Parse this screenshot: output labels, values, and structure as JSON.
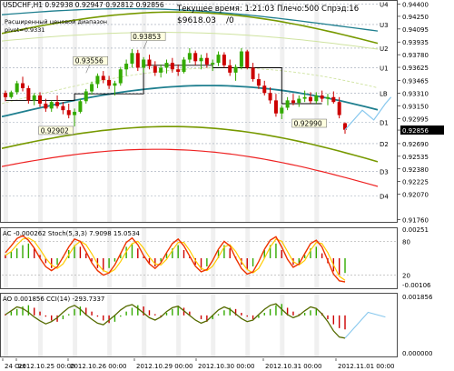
{
  "header": {
    "symbol_line": "USDCHF,H1  0.92938 0.92947 0.92812 0.92856",
    "range_label": "Расширенный ценовой диапазон",
    "pivot_label": "pivot=0.9331",
    "time_label": "Текущее время: 1:21:03 Плечо:500 Спрэд:16",
    "balance_label": "$9618.03",
    "balance_extra": "/0"
  },
  "colors": {
    "background": "#ffffff",
    "candle_up": "#33aa00",
    "candle_down": "#cc0000",
    "band_outer": "#779900",
    "band_mid": "#cfe3a0",
    "ma_teal": "#1f7f8f",
    "ma_red": "#ee2222",
    "level_line": "#9aa5b5",
    "forecast": "#88c8ee",
    "stoch_main": "#ee3300",
    "stoch_signal": "#ffcc00",
    "ac_up": "#33aa00",
    "ac_down": "#cc0000",
    "cci": "#556b00"
  },
  "chart_data": [
    {
      "type": "candlestick",
      "symbol": "USDCHF",
      "timeframe": "H1",
      "last_price": 0.92856,
      "ohlc_current": {
        "open": 0.92938,
        "high": 0.92947,
        "low": 0.92812,
        "close": 0.92856
      },
      "ylim": [
        0.9172,
        0.9445
      ],
      "y_ticks": [
        "0.94400",
        "0.94250",
        "0.94095",
        "0.93935",
        "0.93780",
        "0.93625",
        "0.93465",
        "0.93310",
        "0.93150",
        "0.92995",
        "0.92856",
        "0.92690",
        "0.92535",
        "0.92380",
        "0.92225",
        "0.92070",
        "0.91760"
      ],
      "pivot_levels": [
        {
          "name": "U4",
          "value": 0.944
        },
        {
          "name": "U3",
          "value": 0.9415
        },
        {
          "name": "U2",
          "value": 0.9386
        },
        {
          "name": "U1",
          "value": 0.9362
        },
        {
          "name": "LB",
          "value": 0.9331
        },
        {
          "name": "D1",
          "value": 0.9295
        },
        {
          "name": "D2",
          "value": 0.9269
        },
        {
          "name": "D3",
          "value": 0.9235
        },
        {
          "name": "D4",
          "value": 0.9205
        }
      ],
      "annotations": [
        {
          "text": "0.93853",
          "value": 0.93853
        },
        {
          "text": "0.93556",
          "value": 0.93556
        },
        {
          "text": "0.92902",
          "value": 0.92902
        },
        {
          "text": "0.92990",
          "value": 0.9299
        }
      ],
      "candles": [
        [
          0.9331,
          0.9334,
          0.9321,
          0.9326
        ],
        [
          0.9326,
          0.9334,
          0.9324,
          0.9332
        ],
        [
          0.9332,
          0.9346,
          0.9329,
          0.9343
        ],
        [
          0.9343,
          0.9351,
          0.9333,
          0.9337
        ],
        [
          0.9337,
          0.934,
          0.9318,
          0.9322
        ],
        [
          0.9322,
          0.9331,
          0.9316,
          0.9328
        ],
        [
          0.9328,
          0.9332,
          0.9314,
          0.9318
        ],
        [
          0.9318,
          0.9324,
          0.9308,
          0.9312
        ],
        [
          0.9312,
          0.9322,
          0.9308,
          0.932
        ],
        [
          0.932,
          0.9328,
          0.9312,
          0.9315
        ],
        [
          0.9315,
          0.932,
          0.9305,
          0.931
        ],
        [
          0.931,
          0.9318,
          0.93,
          0.9304
        ],
        [
          0.9304,
          0.9312,
          0.929,
          0.9308
        ],
        [
          0.9308,
          0.9324,
          0.9306,
          0.9321
        ],
        [
          0.9321,
          0.9336,
          0.9318,
          0.9333
        ],
        [
          0.9333,
          0.9345,
          0.9329,
          0.9342
        ],
        [
          0.9342,
          0.9355,
          0.9337,
          0.9352
        ],
        [
          0.9352,
          0.9358,
          0.9343,
          0.9347
        ],
        [
          0.9347,
          0.9352,
          0.9336,
          0.934
        ],
        [
          0.934,
          0.9346,
          0.9328,
          0.9343
        ],
        [
          0.9343,
          0.9363,
          0.934,
          0.936
        ],
        [
          0.936,
          0.9372,
          0.9352,
          0.9367
        ],
        [
          0.9367,
          0.9385,
          0.9362,
          0.938
        ],
        [
          0.938,
          0.9384,
          0.9358,
          0.9362
        ],
        [
          0.9362,
          0.9375,
          0.9356,
          0.9372
        ],
        [
          0.9372,
          0.9378,
          0.936,
          0.9364
        ],
        [
          0.9364,
          0.937,
          0.9352,
          0.9356
        ],
        [
          0.9356,
          0.9366,
          0.935,
          0.9362
        ],
        [
          0.9362,
          0.9372,
          0.9355,
          0.9368
        ],
        [
          0.9368,
          0.9374,
          0.9356,
          0.936
        ],
        [
          0.936,
          0.9366,
          0.9352,
          0.9357
        ],
        [
          0.9357,
          0.9375,
          0.9355,
          0.9372
        ],
        [
          0.9372,
          0.9386,
          0.9368,
          0.938
        ],
        [
          0.938,
          0.9383,
          0.9365,
          0.937
        ],
        [
          0.937,
          0.9378,
          0.936,
          0.9374
        ],
        [
          0.9374,
          0.938,
          0.9362,
          0.9366
        ],
        [
          0.9366,
          0.9372,
          0.9358,
          0.9368
        ],
        [
          0.9368,
          0.9382,
          0.9364,
          0.9378
        ],
        [
          0.9378,
          0.9381,
          0.9362,
          0.9365
        ],
        [
          0.9365,
          0.9372,
          0.9352,
          0.9356
        ],
        [
          0.9356,
          0.9366,
          0.9346,
          0.9363
        ],
        [
          0.9363,
          0.9386,
          0.936,
          0.9382
        ],
        [
          0.9382,
          0.9384,
          0.936,
          0.9362
        ],
        [
          0.9362,
          0.9368,
          0.9345,
          0.9348
        ],
        [
          0.9348,
          0.9355,
          0.9336,
          0.934
        ],
        [
          0.934,
          0.9346,
          0.9328,
          0.9331
        ],
        [
          0.9331,
          0.9338,
          0.9318,
          0.9322
        ],
        [
          0.9322,
          0.933,
          0.9302,
          0.9306
        ],
        [
          0.9306,
          0.9316,
          0.9299,
          0.9313
        ],
        [
          0.9313,
          0.9326,
          0.931,
          0.9322
        ],
        [
          0.9322,
          0.933,
          0.9316,
          0.9319
        ],
        [
          0.9319,
          0.9328,
          0.9314,
          0.9324
        ],
        [
          0.9324,
          0.9334,
          0.932,
          0.9326
        ],
        [
          0.9326,
          0.9332,
          0.9318,
          0.9321
        ],
        [
          0.9321,
          0.9332,
          0.9318,
          0.9328
        ],
        [
          0.9328,
          0.9334,
          0.932,
          0.9324
        ],
        [
          0.9324,
          0.933,
          0.9316,
          0.9326
        ],
        [
          0.9326,
          0.9333,
          0.9318,
          0.932
        ],
        [
          0.932,
          0.9326,
          0.93,
          0.9304
        ],
        [
          0.9294,
          0.9295,
          0.9281,
          0.9286
        ]
      ],
      "x_labels": [
        "24 Oct",
        "2012.10.25 00:00",
        "2012.10.26 00:00",
        "2012.10.29 00:00",
        "2012.10.30 00:00",
        "2012.10.31 00:00",
        "2012.11.01 00:00"
      ]
    },
    {
      "type": "line",
      "title": "AC -0.000262  Stoch(5,3,3) 7.9098 15.0534",
      "ylim": [
        -0.00106,
        0.00251
      ],
      "y_ticks": [
        "0.00251",
        "80",
        "20",
        "-0.00106"
      ],
      "levels": [
        80,
        20
      ],
      "stoch_main": [
        60,
        72,
        85,
        90,
        82,
        68,
        50,
        35,
        28,
        35,
        52,
        70,
        84,
        80,
        62,
        42,
        28,
        20,
        24,
        38,
        58,
        78,
        86,
        74,
        55,
        40,
        32,
        42,
        60,
        76,
        84,
        72,
        54,
        36,
        26,
        30,
        46,
        66,
        80,
        72,
        50,
        32,
        22,
        26,
        44,
        66,
        82,
        88,
        70,
        48,
        34,
        40,
        58,
        76,
        82,
        70,
        46,
        22,
        10,
        8
      ],
      "stoch_signal": [
        55,
        62,
        74,
        84,
        86,
        80,
        66,
        50,
        38,
        32,
        40,
        56,
        72,
        80,
        74,
        58,
        40,
        28,
        24,
        30,
        44,
        62,
        76,
        80,
        68,
        52,
        40,
        38,
        48,
        64,
        78,
        78,
        64,
        46,
        32,
        28,
        36,
        52,
        70,
        74,
        62,
        44,
        30,
        24,
        32,
        50,
        70,
        84,
        80,
        62,
        44,
        38,
        46,
        64,
        78,
        76,
        60,
        38,
        18,
        11
      ],
      "ac_histogram": [
        0.2,
        0.4,
        0.6,
        0.8,
        0.9,
        0.6,
        0.2,
        -0.3,
        -0.6,
        -0.4,
        0.1,
        0.5,
        0.8,
        0.7,
        0.3,
        -0.2,
        -0.6,
        -0.8,
        -0.6,
        -0.2,
        0.3,
        0.7,
        0.9,
        0.6,
        0.1,
        -0.3,
        -0.5,
        -0.2,
        0.3,
        0.6,
        0.8,
        0.5,
        0.1,
        -0.4,
        -0.7,
        -0.5,
        0,
        0.5,
        0.8,
        0.6,
        0.1,
        -0.4,
        -0.7,
        -0.5,
        0,
        0.5,
        0.8,
        0.9,
        0.5,
        0,
        -0.4,
        -0.3,
        0.2,
        0.6,
        0.7,
        0.3,
        -0.3,
        -0.8,
        -1.0,
        -0.9
      ]
    },
    {
      "type": "line",
      "title": "AO 0.001856  CCI(14) -293.7337",
      "ylim": [
        -0.001,
        0.0012
      ],
      "y_ticks": [
        "0.001856",
        "0.000000"
      ],
      "cci": [
        10,
        60,
        110,
        90,
        40,
        -20,
        -70,
        -110,
        -80,
        -30,
        40,
        100,
        130,
        80,
        10,
        -50,
        -100,
        -120,
        -60,
        0,
        70,
        120,
        140,
        90,
        30,
        -30,
        -60,
        -20,
        50,
        100,
        120,
        60,
        0,
        -60,
        -100,
        -70,
        0,
        70,
        110,
        80,
        20,
        -40,
        -80,
        -60,
        10,
        80,
        130,
        150,
        80,
        10,
        -30,
        0,
        60,
        110,
        90,
        20,
        -80,
        -200,
        -280,
        -294
      ],
      "ao_histogram": [
        0.1,
        0.3,
        0.5,
        0.7,
        0.8,
        0.6,
        0.3,
        -0.1,
        -0.4,
        -0.5,
        -0.3,
        0.1,
        0.5,
        0.7,
        0.6,
        0.3,
        -0.1,
        -0.4,
        -0.6,
        -0.5,
        -0.1,
        0.3,
        0.6,
        0.8,
        0.7,
        0.4,
        0.1,
        -0.1,
        0.2,
        0.5,
        0.7,
        0.6,
        0.3,
        0,
        -0.3,
        -0.5,
        -0.3,
        0.1,
        0.4,
        0.6,
        0.5,
        0.2,
        -0.1,
        -0.3,
        -0.2,
        0.2,
        0.5,
        0.8,
        0.9,
        0.6,
        0.3,
        0.1,
        0.2,
        0.4,
        0.5,
        0.2,
        -0.3,
        -0.7,
        -1.0,
        -1.1
      ]
    }
  ]
}
